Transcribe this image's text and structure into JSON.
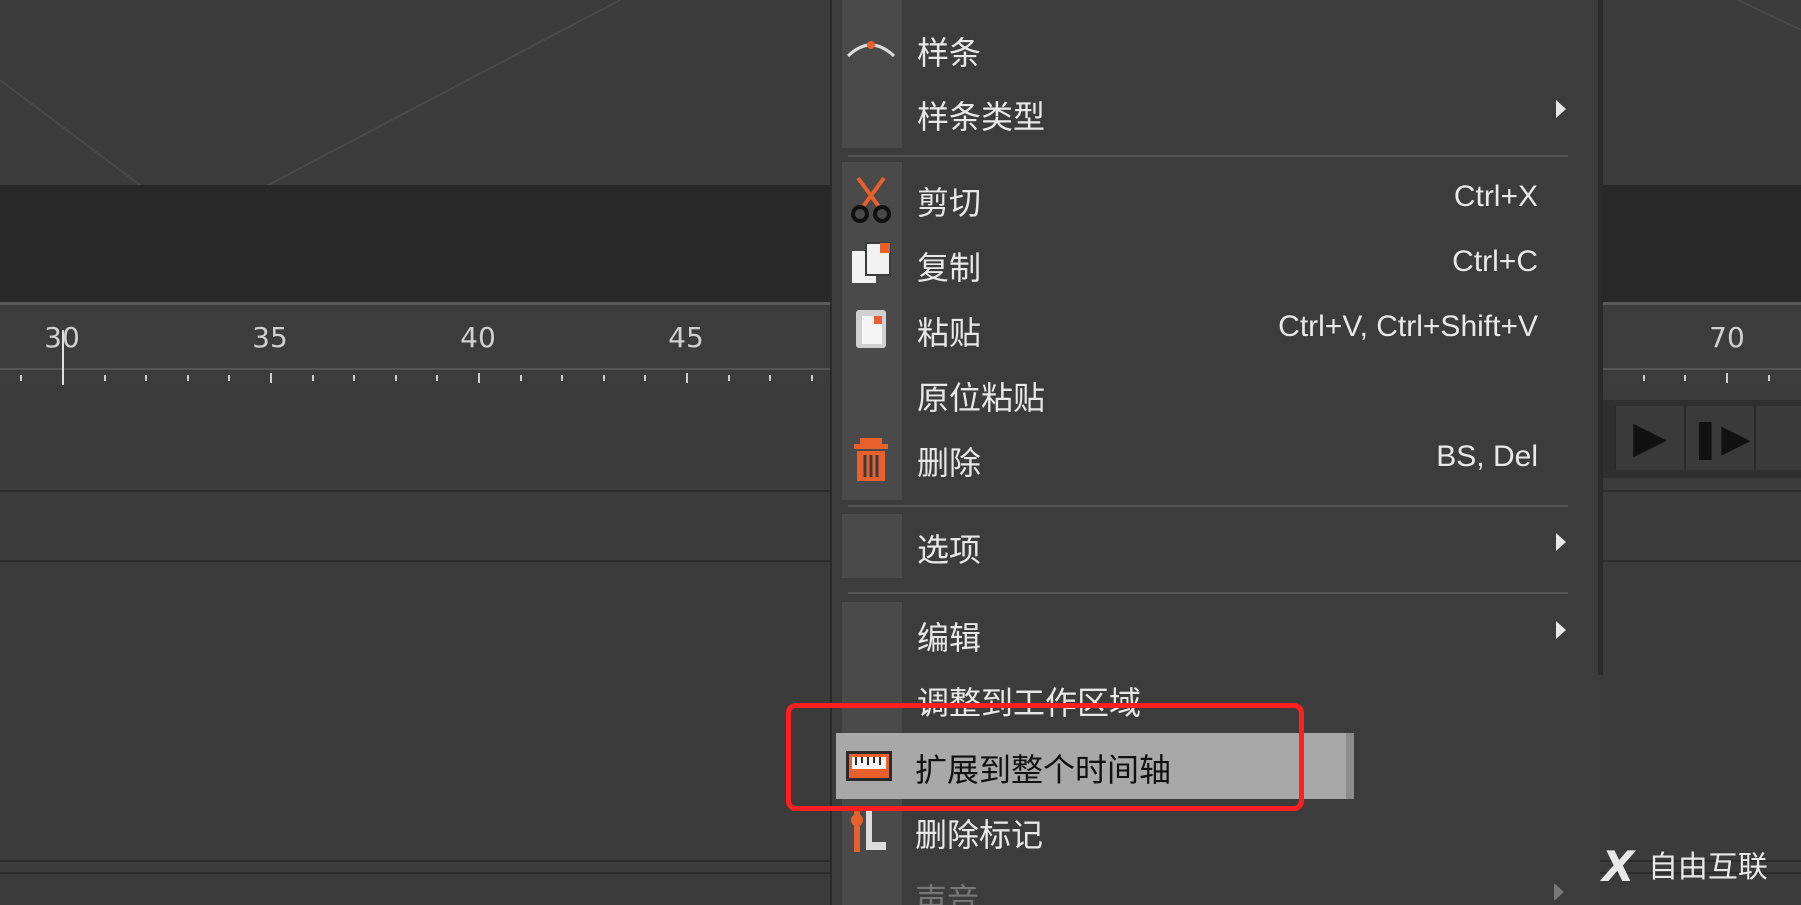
{
  "ruler": {
    "labels": [
      "30",
      "35",
      "40",
      "45",
      "70"
    ]
  },
  "menu": {
    "items": [
      {
        "label": "样条",
        "icon": "spline-icon"
      },
      {
        "label": "样条类型",
        "submenu": true
      },
      {
        "label": "剪切",
        "shortcut": "Ctrl+X",
        "icon": "scissors-icon"
      },
      {
        "label": "复制",
        "shortcut": "Ctrl+C",
        "icon": "copy-icon"
      },
      {
        "label": "粘贴",
        "shortcut": "Ctrl+V, Ctrl+Shift+V",
        "icon": "paste-icon"
      },
      {
        "label": "原位粘贴"
      },
      {
        "label": "删除",
        "shortcut": "BS, Del",
        "icon": "trash-icon"
      },
      {
        "label": "选项",
        "submenu": true
      },
      {
        "label": "编辑",
        "submenu": true
      },
      {
        "label": "调整到工作区域"
      },
      {
        "label": "扩展到整个时间轴",
        "icon": "timeline-ruler-icon",
        "highlighted": true
      },
      {
        "label": "删除标记",
        "icon": "marker-icon"
      },
      {
        "label": "声音",
        "submenu": true,
        "disabled": true
      }
    ]
  },
  "transport": {
    "play": "play-icon",
    "step": "step-forward-icon"
  },
  "watermark": {
    "mark": "X",
    "text": "自由互联"
  },
  "colors": {
    "highlight": "#a8a8a8",
    "annotation": "#ff1f1f",
    "icon_accent": "#e8602c"
  }
}
